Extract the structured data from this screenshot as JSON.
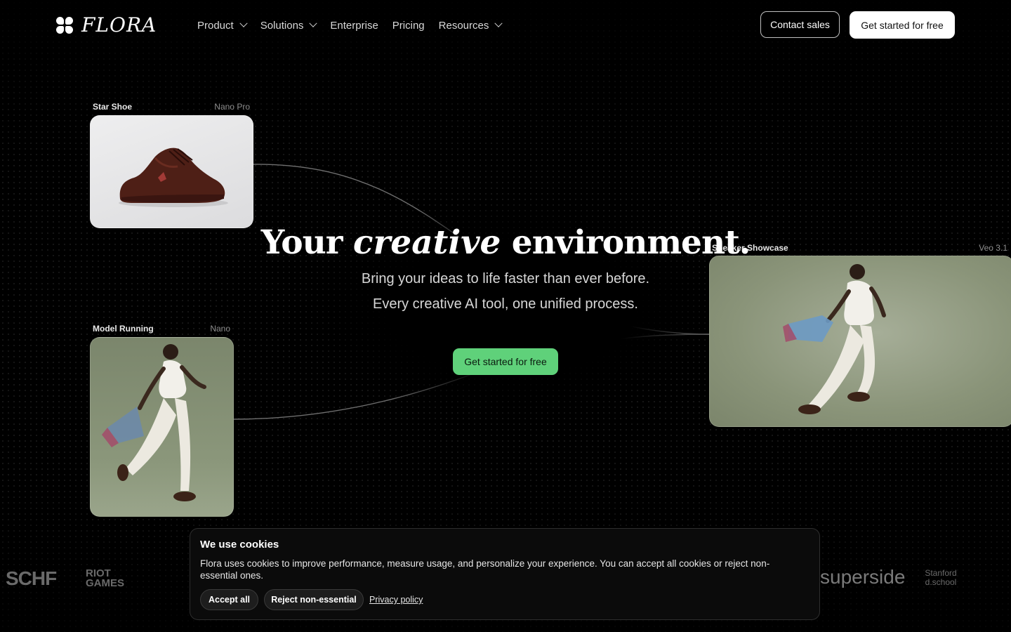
{
  "nav": {
    "brand": "FLORA",
    "items": [
      {
        "label": "Product",
        "has_dropdown": true
      },
      {
        "label": "Solutions",
        "has_dropdown": true
      },
      {
        "label": "Enterprise",
        "has_dropdown": false
      },
      {
        "label": "Pricing",
        "has_dropdown": false
      },
      {
        "label": "Resources",
        "has_dropdown": true
      }
    ],
    "contact_label": "Contact sales",
    "start_label": "Get started for free"
  },
  "cards": {
    "shoe": {
      "title": "Star Shoe",
      "model": "Nano Pro"
    },
    "running": {
      "title": "Model Running",
      "model": "Nano"
    },
    "showcase": {
      "title": "Sneaker Showcase",
      "model": "Veo 3.1"
    }
  },
  "hero": {
    "title_before": "Your",
    "title_em": "creative",
    "title_after": "environment.",
    "subtitle_line1": "Bring your ideas to life faster than ever before.",
    "subtitle_line2": "Every creative AI tool, one unified process.",
    "cta_label": "Get started for free"
  },
  "logos": [
    "SCHF",
    "RIOT GAMES",
    "superside",
    "Stanford d.school"
  ],
  "cookie": {
    "title": "We use cookies",
    "text": "Flora uses cookies to improve performance, measure usage, and personalize your experience. You can accept all cookies or reject non-essential ones.",
    "accept_label": "Accept all",
    "reject_label": "Reject non-essential",
    "privacy_label": "Privacy policy"
  },
  "colors": {
    "background": "#000000",
    "cta_green": "#5fd17a"
  }
}
